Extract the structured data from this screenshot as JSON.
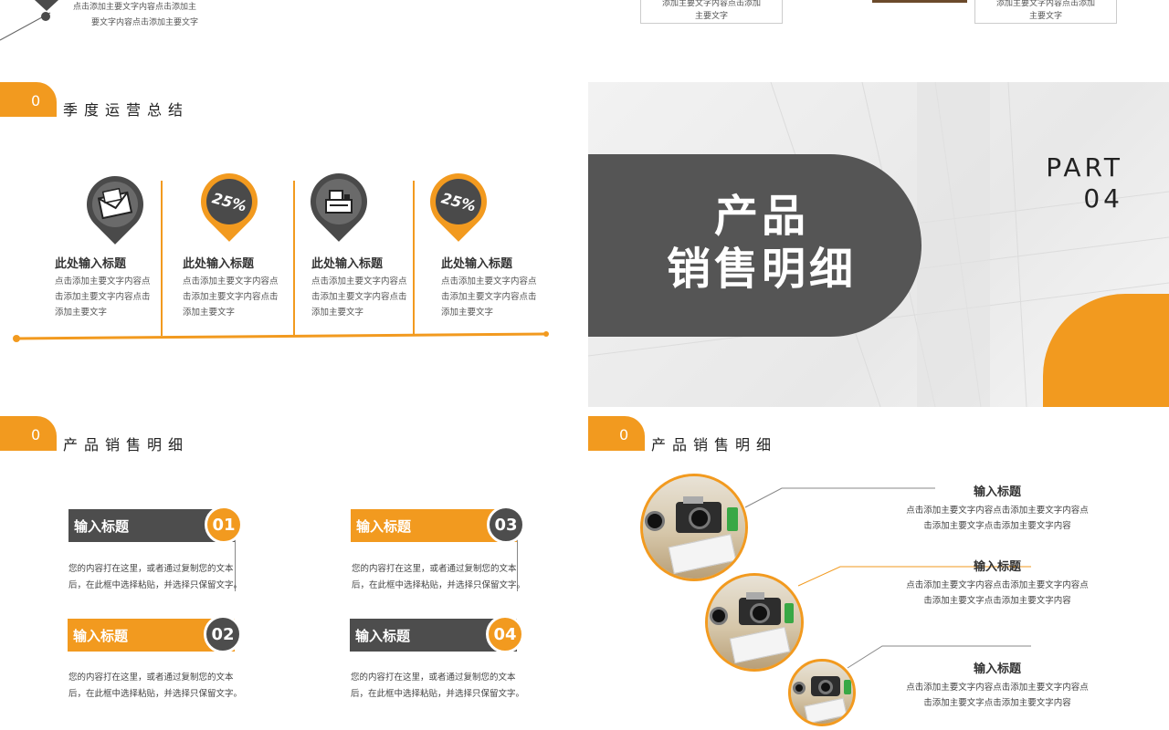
{
  "top_strip": {
    "left_note_line1": "点击添加主要文字内容点击添加主",
    "left_note_line2": "要文字内容点击添加主要文字",
    "box1_line1": "添加主要文字内容点击添加",
    "box1_line2": "主要文字",
    "box2_line1": "添加主要文字内容点击添加",
    "box2_line2": "主要文字"
  },
  "slide1": {
    "section_number": "0",
    "section_title": "季度运营总结",
    "cards": [
      {
        "icon": "envelope-icon",
        "badge": "",
        "title": "此处输入标题",
        "text": "点击添加主要文字内容点击添加主要文字内容点击添加主要文字"
      },
      {
        "icon": "percent-badge",
        "badge": "25%",
        "title": "此处输入标题",
        "text": "点击添加主要文字内容点击添加主要文字内容点击添加主要文字"
      },
      {
        "icon": "cash-register-icon",
        "badge": "",
        "title": "此处输入标题",
        "text": "点击添加主要文字内容点击添加主要文字内容点击添加主要文字"
      },
      {
        "icon": "percent-badge",
        "badge": "25%",
        "title": "此处输入标题",
        "text": "点击添加主要文字内容点击添加主要文字内容点击添加主要文字"
      }
    ]
  },
  "slide2": {
    "title_line1": "产品",
    "title_line2": "销售明细",
    "part_line1": "PART",
    "part_line2": "04"
  },
  "slide3": {
    "section_number": "0",
    "section_title": "产品销售明细",
    "items": [
      {
        "title": "输入标题",
        "num": "01",
        "text_line1": "您的内容打在这里，或者通过复制您的文本",
        "text_line2": "后，在此框中选择粘贴，并选择只保留文字。"
      },
      {
        "title": "输入标题",
        "num": "02",
        "text_line1": "您的内容打在这里，或者通过复制您的文本",
        "text_line2": "后，在此框中选择粘贴，并选择只保留文字。"
      },
      {
        "title": "输入标题",
        "num": "03",
        "text_line1": "您的内容打在这里，或者通过复制您的文本",
        "text_line2": "后，在此框中选择粘贴，并选择只保留文字。"
      },
      {
        "title": "输入标题",
        "num": "04",
        "text_line1": "您的内容打在这里，或者通过复制您的文本",
        "text_line2": "后，在此框中选择粘贴，并选择只保留文字。"
      }
    ]
  },
  "slide4": {
    "section_number": "0",
    "section_title": "产品销售明细",
    "infos": [
      {
        "title": "输入标题",
        "line1": "点击添加主要文字内容点击添加主要文字内容点",
        "line2": "击添加主要文字点击添加主要文字内容"
      },
      {
        "title": "输入标题",
        "line1": "点击添加主要文字内容点击添加主要文字内容点",
        "line2": "击添加主要文字点击添加主要文字内容"
      },
      {
        "title": "输入标题",
        "line1": "点击添加主要文字内容点击添加主要文字内容点",
        "line2": "击添加主要文字点击添加主要文字内容"
      }
    ]
  },
  "colors": {
    "accent": "#f29a1f",
    "dark": "#4a4a4a"
  }
}
